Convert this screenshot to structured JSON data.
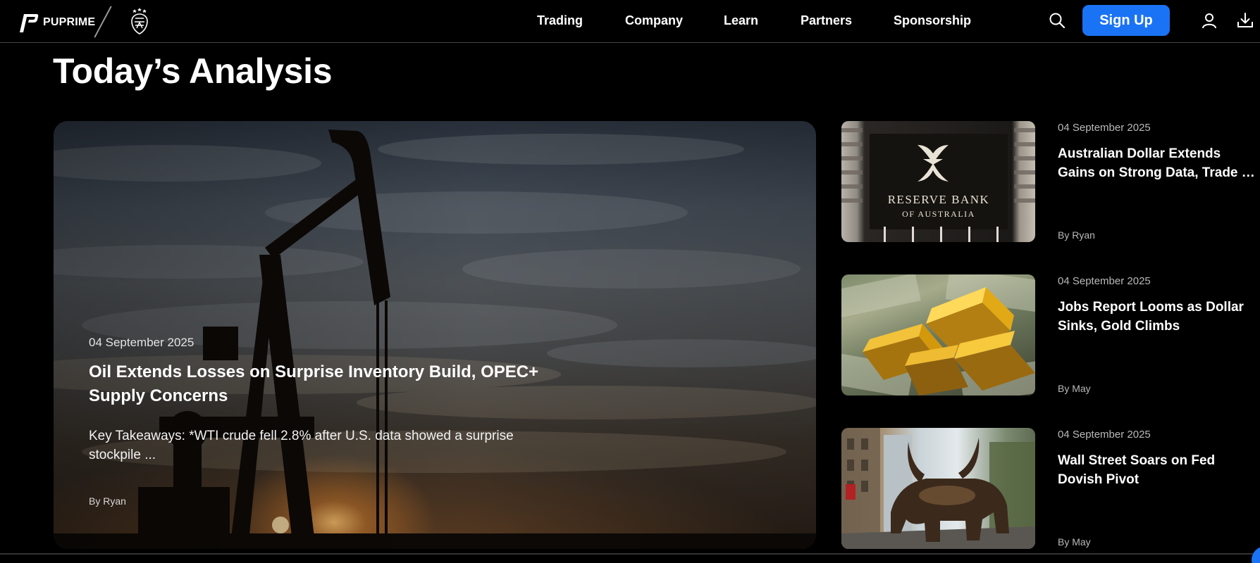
{
  "brand": {
    "name": "PUPRIME"
  },
  "nav": {
    "items": [
      {
        "label": "Trading"
      },
      {
        "label": "Company"
      },
      {
        "label": "Learn"
      },
      {
        "label": "Partners"
      },
      {
        "label": "Sponsorship"
      }
    ],
    "signup_label": "Sign Up"
  },
  "colors": {
    "accent": "#1a73f5",
    "background": "#000000"
  },
  "icons": {
    "search": "search-icon",
    "user": "user-icon",
    "download": "download-icon"
  },
  "page": {
    "title": "Today’s Analysis"
  },
  "featured": {
    "date": "04 September 2025",
    "title": "Oil Extends Losses on Surprise Inventory Build, OPEC+ Supply Concerns",
    "excerpt": "Key Takeaways: *WTI crude fell 2.8% after U.S. data showed a surprise stockpile ...",
    "author": "By Ryan"
  },
  "articles": [
    {
      "date": "04 September 2025",
      "title_line1": "Australian Dollar Extends",
      "title_line2": "Gains on Strong Data, Trade Talks",
      "author": "By Ryan",
      "thumb_text_1": "RESERVE BANK",
      "thumb_text_2": "OF AUSTRALIA"
    },
    {
      "date": "04 September 2025",
      "title_line1": "Jobs Report Looms as Dollar",
      "title_line2": "Sinks, Gold Climbs",
      "author": "By May"
    },
    {
      "date": "04 September 2025",
      "title_line1": "Wall Street Soars on Fed",
      "title_line2": "Dovish Pivot",
      "author": "By May"
    }
  ]
}
